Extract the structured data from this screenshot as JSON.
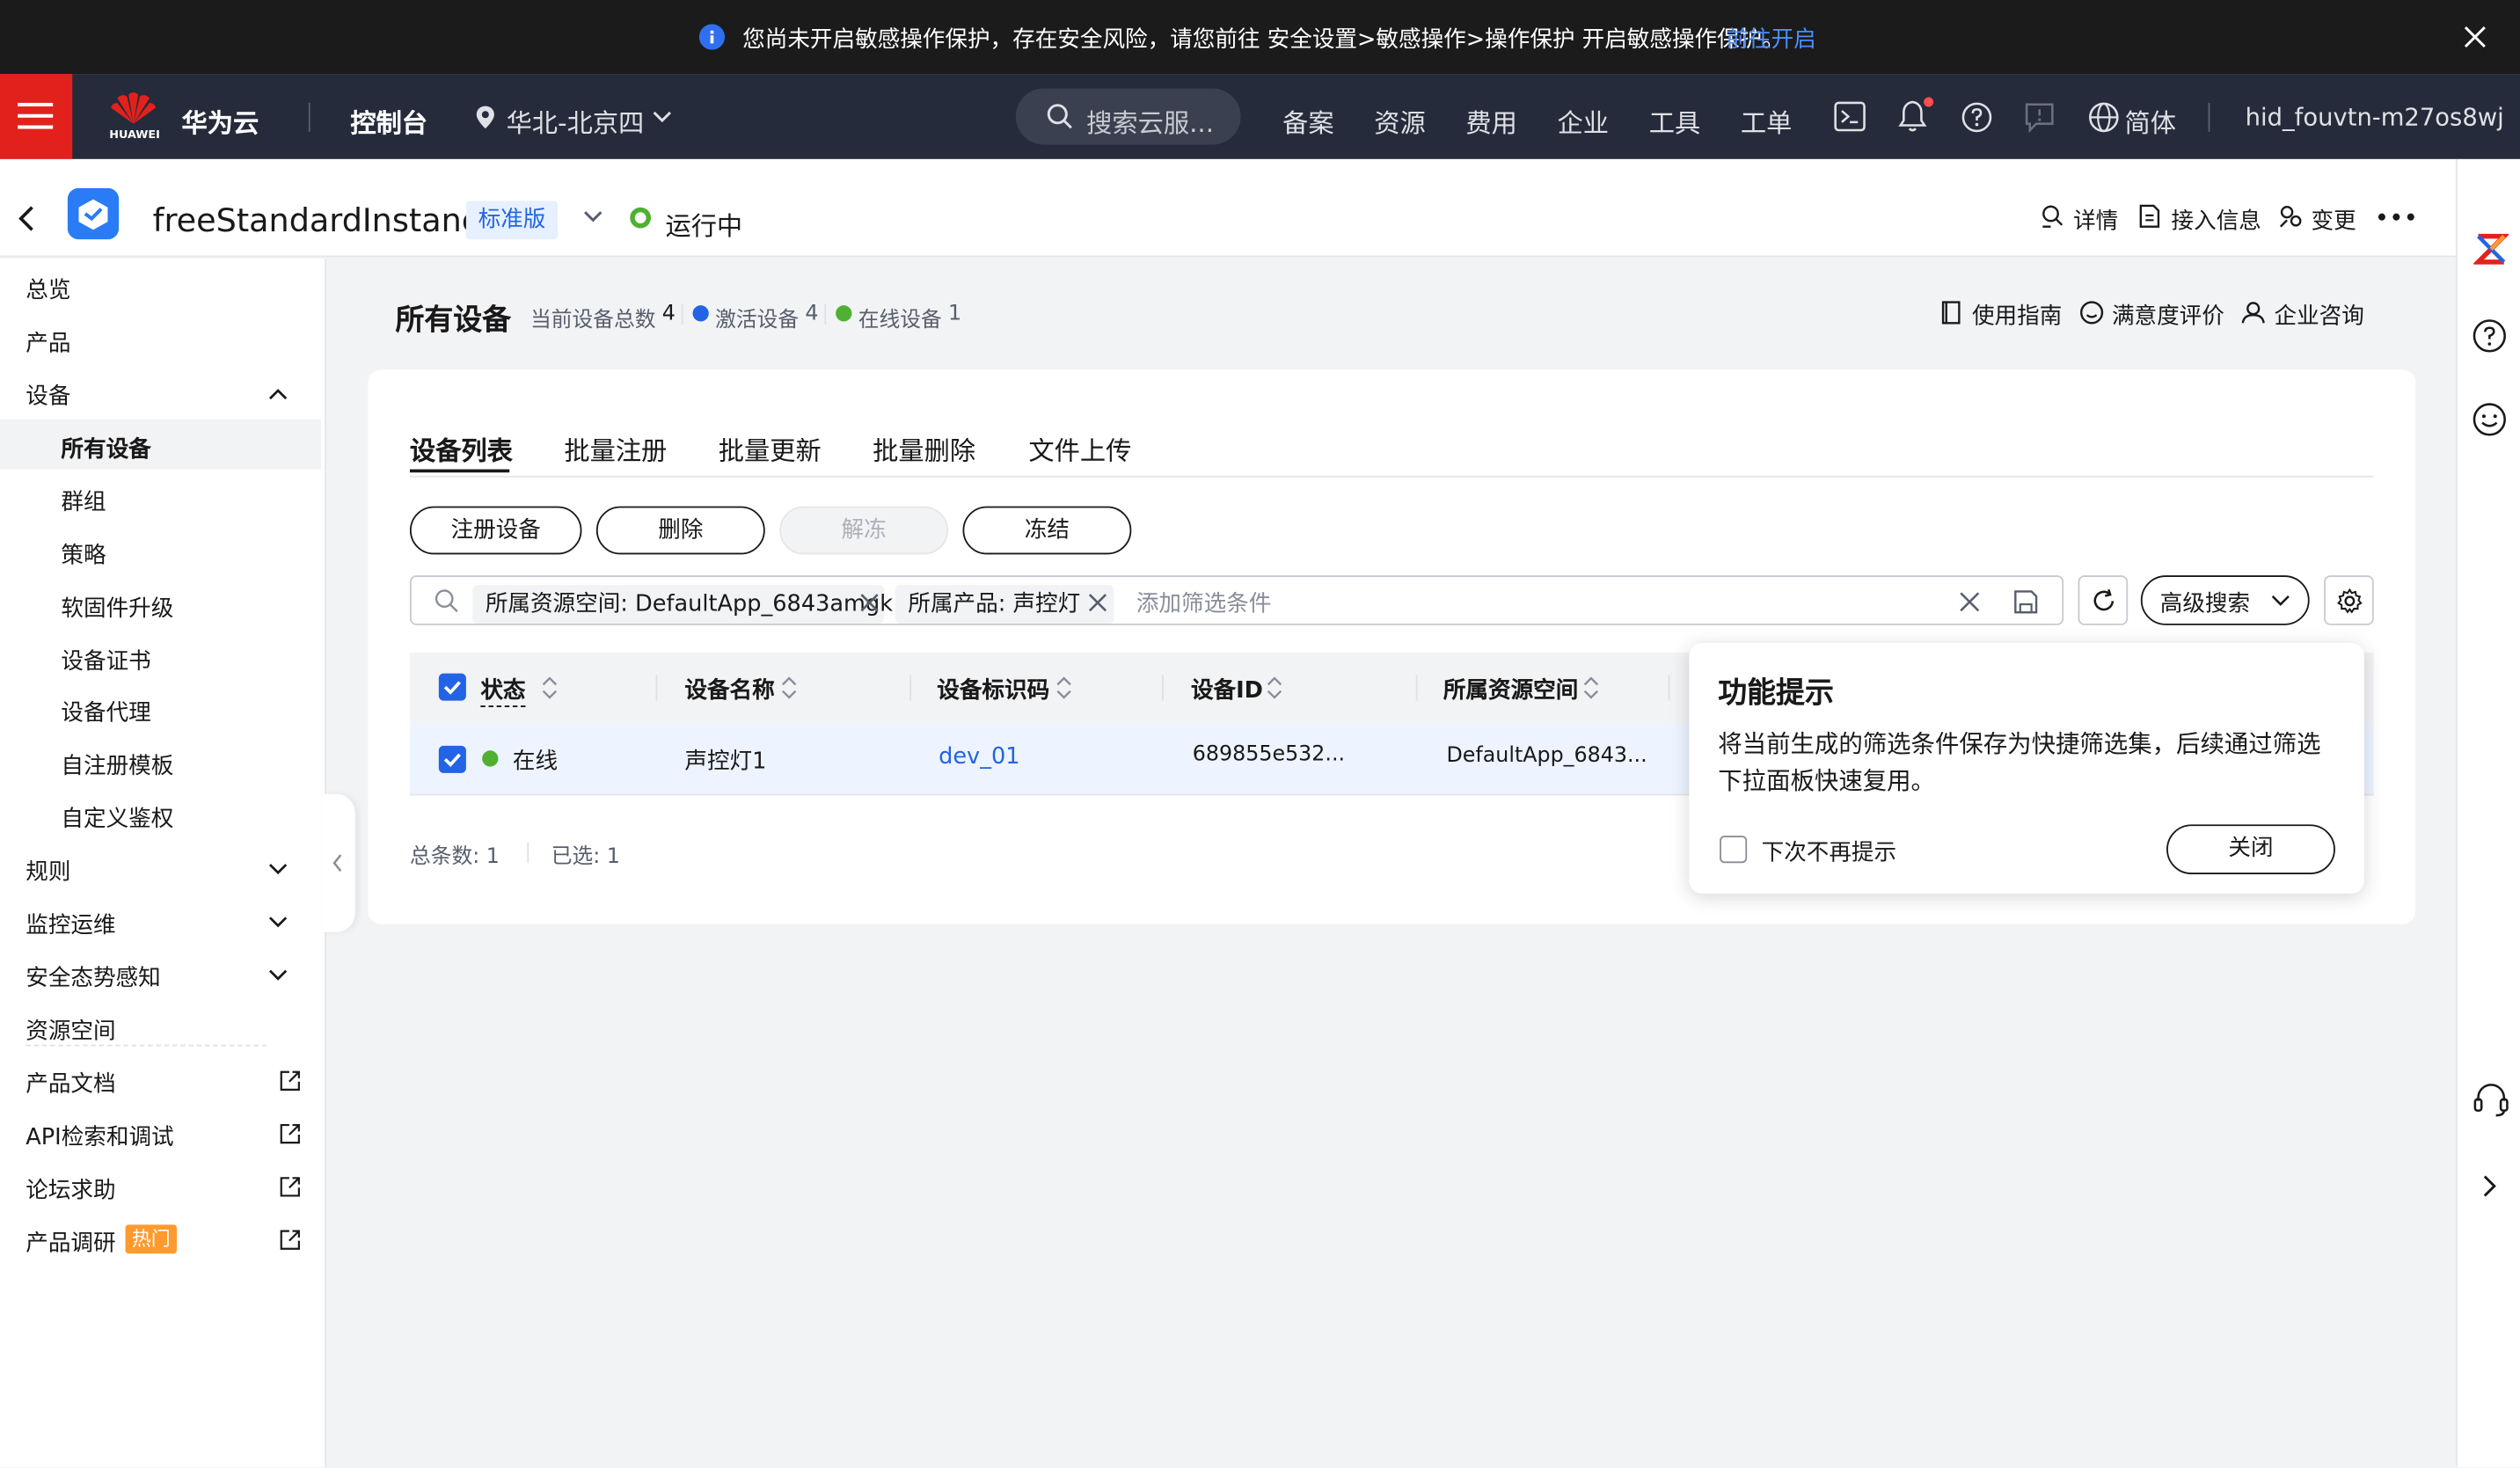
{
  "banner": {
    "message": "您尚未开启敏感操作保护，存在安全风险，请您前往 安全设置>敏感操作>操作保护 开启敏感操作保护。",
    "link": "前往开启"
  },
  "topnav": {
    "brand_small": "HUAWEI",
    "brand": "华为云",
    "console": "控制台",
    "region": "华北-北京四",
    "search_placeholder": "搜索云服...",
    "menu": [
      "备案",
      "资源",
      "费用",
      "企业",
      "工具",
      "工单"
    ],
    "language": "简体",
    "user": "hid_fouvtn-m27os8wj"
  },
  "instance": {
    "name": "freeStandardInstance",
    "edition": "标准版",
    "status": "运行中",
    "actions": [
      "详情",
      "接入信息",
      "变更"
    ]
  },
  "sidebar": {
    "items": [
      "总览",
      "产品",
      "设备"
    ],
    "device_sub": [
      "所有设备",
      "群组",
      "策略",
      "软固件升级",
      "设备证书",
      "设备代理",
      "自注册模板",
      "自定义鉴权"
    ],
    "groups": [
      "规则",
      "监控运维",
      "安全态势感知",
      "资源空间"
    ],
    "links": [
      "产品文档",
      "API检索和调试",
      "论坛求助",
      "产品调研"
    ],
    "hot_badge": "热门"
  },
  "page": {
    "title": "所有设备",
    "total_label": "当前设备总数",
    "total": "4",
    "active_label": "激活设备",
    "active": "4",
    "online_label": "在线设备",
    "online": "1",
    "help_links": [
      "使用指南",
      "满意度评价",
      "企业咨询"
    ]
  },
  "tabs": [
    "设备列表",
    "批量注册",
    "批量更新",
    "批量删除",
    "文件上传"
  ],
  "actions": {
    "register": "注册设备",
    "delete": "删除",
    "unfreeze": "解冻",
    "freeze": "冻结"
  },
  "filter": {
    "chips": [
      "所属资源空间: DefaultApp_6843amgk",
      "所属产品: 声控灯"
    ],
    "placeholder": "添加筛选条件",
    "advanced": "高级搜索"
  },
  "table": {
    "columns": [
      "状态",
      "设备名称",
      "设备标识码",
      "设备ID",
      "所属资源空间"
    ],
    "rows": [
      {
        "status": "在线",
        "name": "声控灯1",
        "node_id": "dev_01",
        "device_id": "689855e532...",
        "app": "DefaultApp_6843..."
      }
    ],
    "total_label": "总条数: 1",
    "selected_label": "已选: 1"
  },
  "tip": {
    "title": "功能提示",
    "body_line1": "将当前生成的筛选条件保存为快捷筛选集，后续通过筛选",
    "body_line2": "下拉面板快速复用。",
    "dont_show": "下次不再提示",
    "close": "关闭"
  },
  "colors": {
    "brand_red": "#e3211c",
    "primary_blue": "#2264e5",
    "online_green": "#50b031",
    "active_blue": "#2264e5",
    "hot_orange": "#ff9a2e",
    "topnav_bg": "#252b3a",
    "banner_bg": "#1b1b1b"
  }
}
